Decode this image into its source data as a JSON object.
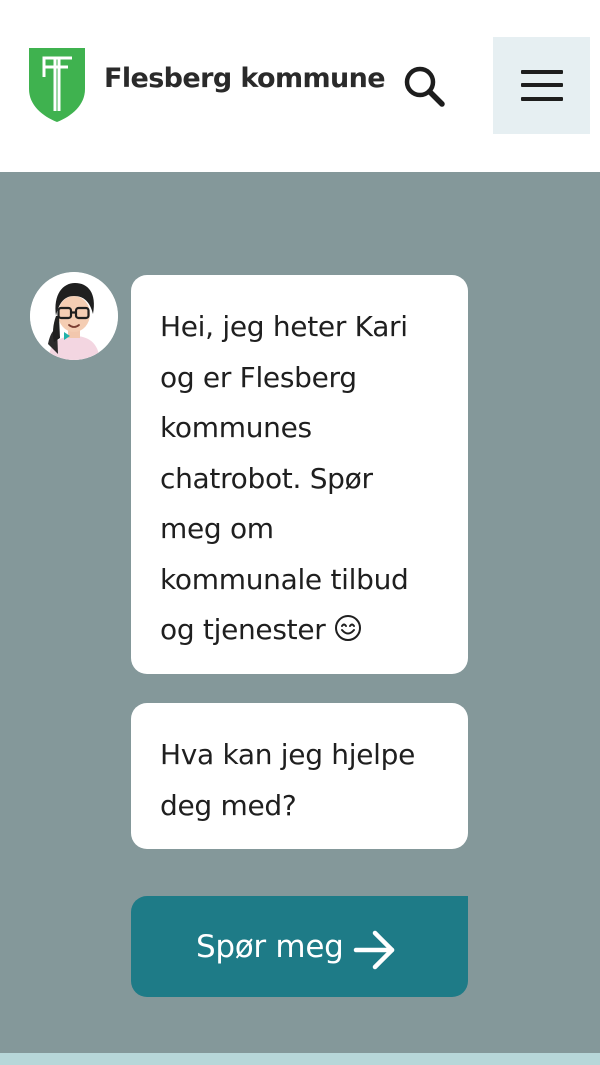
{
  "header": {
    "brand_name": "Flesberg kommune",
    "logo_icon": "flesberg-coat-of-arms-shield",
    "search_icon": "search-icon",
    "menu_icon": "hamburger-menu-icon"
  },
  "chat": {
    "avatar_icon": "chatbot-kari-avatar",
    "messages": [
      {
        "lines": [
          "Hei, jeg heter Kari",
          "og er Flesberg",
          "kommunes",
          "chatrobot. Spør",
          "meg om",
          "kommunale tilbud",
          "og tjenester"
        ],
        "emoji": "smiling-face-emoji"
      },
      {
        "lines": [
          "Hva kan jeg hjelpe",
          "deg med?"
        ]
      }
    ],
    "cta_label": "Spør meg",
    "cta_icon": "arrow-right-icon"
  },
  "colors": {
    "brand_green": "#3fb24f",
    "chat_background": "#84989a",
    "bubble_background": "#ffffff",
    "cta_background": "#1e7b87",
    "menu_button_background": "#e6eff2",
    "footer_band": "#b7d7d9"
  }
}
